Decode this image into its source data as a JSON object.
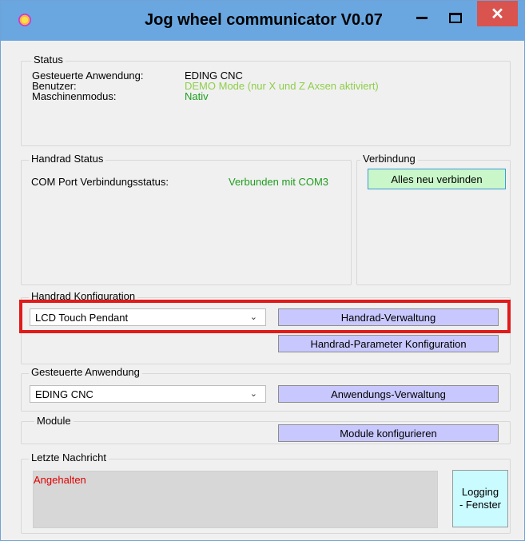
{
  "window": {
    "title": "Jog wheel communicator V0.07",
    "close_glyph": "✕"
  },
  "status": {
    "title": "Status",
    "rows": [
      {
        "label": "Gesteuerte Anwendung:",
        "value": "EDING CNC"
      },
      {
        "label": "Benutzer:",
        "value": "DEMO Mode (nur X und Z Axsen aktiviert)"
      },
      {
        "label": "Maschinenmodus:",
        "value": "Nativ"
      }
    ]
  },
  "handrad_status": {
    "title": "Handrad Status",
    "com_label": "COM Port Verbindungsstatus:",
    "com_value": "Verbunden mit COM3"
  },
  "verbindung": {
    "title": "Verbindung",
    "button": "Alles neu verbinden"
  },
  "handrad_konfig": {
    "title": "Handrad Konfiguration",
    "selected": "LCD Touch Pendant",
    "verwaltung_button": "Handrad-Verwaltung",
    "parameter_button": "Handrad-Parameter Konfiguration"
  },
  "anwendung": {
    "title": "Gesteuerte Anwendung",
    "selected": "EDING CNC",
    "button": "Anwendungs-Verwaltung"
  },
  "module": {
    "title": "Module",
    "button": "Module konfigurieren"
  },
  "letzte": {
    "title": "Letzte Nachricht",
    "message": "Angehalten",
    "logging_line1": "Logging",
    "logging_line2": "- Fenster"
  },
  "colors": {
    "titlebar": "#6aa7e0",
    "close": "#d9534f",
    "highlight": "#e11a1a",
    "button": "#c8c8ff"
  }
}
